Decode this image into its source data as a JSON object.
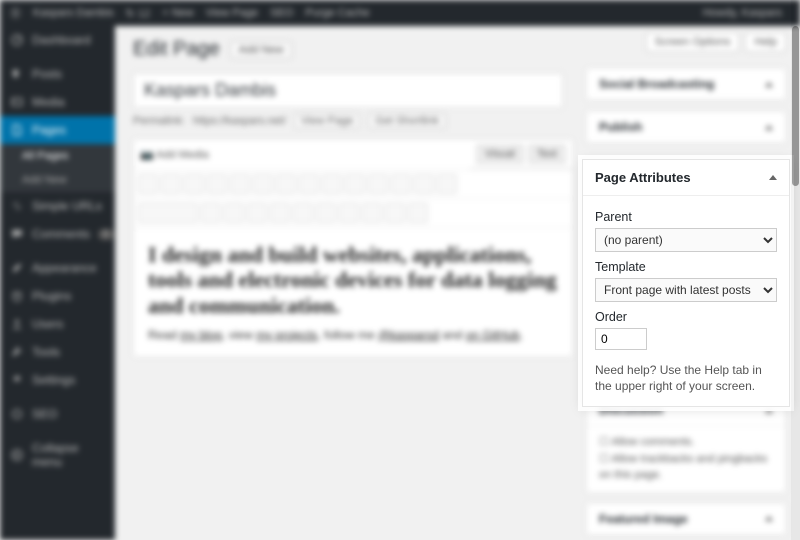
{
  "adminbar": {
    "site": "Kaspars Dambis",
    "updates": "12",
    "new": "+ New",
    "viewpage": "View Page",
    "seo": "SEO",
    "purge": "Purge Cache",
    "howdy": "Howdy, Kaspars"
  },
  "sidebar": {
    "items": [
      {
        "label": "Dashboard"
      },
      {
        "label": "Posts"
      },
      {
        "label": "Media"
      },
      {
        "label": "Pages"
      },
      {
        "label": "Simple URLs"
      },
      {
        "label": "Comments"
      },
      {
        "label": "Appearance"
      },
      {
        "label": "Plugins"
      },
      {
        "label": "Users"
      },
      {
        "label": "Tools"
      },
      {
        "label": "Settings"
      },
      {
        "label": "SEO"
      },
      {
        "label": "Collapse menu"
      }
    ],
    "submenu": {
      "allpages": "All Pages",
      "addnew": "Add New"
    },
    "comments_badge": "0"
  },
  "header": {
    "title": "Edit Page",
    "addnew": "Add New",
    "screen_options": "Screen Options",
    "help": "Help"
  },
  "post": {
    "title": "Kaspars Dambis",
    "permalink_label": "Permalink:",
    "permalink": "https://kaspars.net/",
    "viewpage": "View Page",
    "getshort": "Get Shortlink",
    "addmedia": "Add Media",
    "tabs": {
      "visual": "Visual",
      "text": "Text"
    },
    "body_heading": "I design and build websites, applications, tools and electronic devices for data logging and communication.",
    "body_para_1": "Read ",
    "body_link_1": "my blog",
    "body_para_2": ", view ",
    "body_link_2": "my projects",
    "body_para_3": ", follow me ",
    "body_link_3": "@kasparsd",
    "body_para_4": " and ",
    "body_link_4": "on GitHub",
    "body_para_5": "."
  },
  "metaboxes": {
    "social": "Social Broadcasting",
    "publish": "Publish",
    "page_attributes": {
      "title": "Page Attributes",
      "parent_label": "Parent",
      "parent_value": "(no parent)",
      "template_label": "Template",
      "template_value": "Front page with latest posts",
      "order_label": "Order",
      "order_value": "0",
      "help_text": "Need help? Use the Help tab in the upper right of your screen."
    },
    "discussion": {
      "title": "Discussion",
      "allow_comments": "Allow comments.",
      "allow_pingbacks": "Allow trackbacks and pingbacks on this page."
    },
    "featured": "Featured Image"
  }
}
